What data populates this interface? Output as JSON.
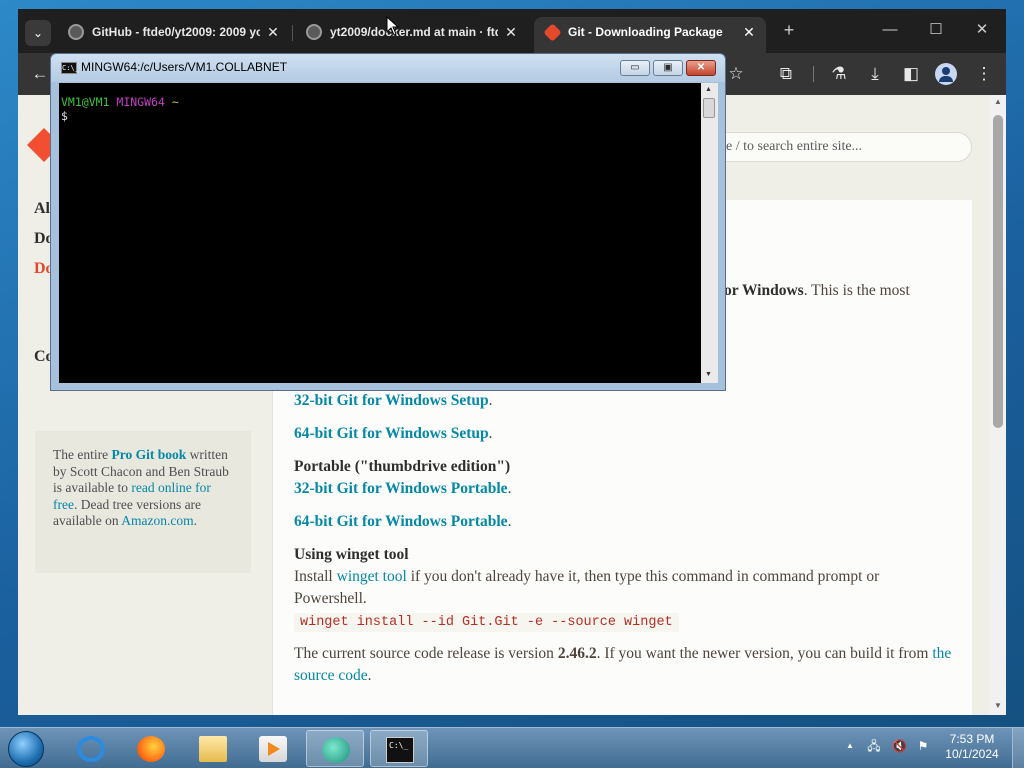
{
  "browser": {
    "tabs": [
      {
        "title": "GitHub - ftde0/yt2009: 2009 yo",
        "close": "✕"
      },
      {
        "title": "yt2009/docker.md at main · ftde",
        "close": "✕"
      },
      {
        "title": "Git - Downloading Package",
        "close": "✕"
      }
    ],
    "tabmenu": "⌄",
    "newtab": "+",
    "window_controls": {
      "minimize": "—",
      "maximize": "☐",
      "close": "✕"
    },
    "toolbar": {
      "back": "←",
      "star": "☆",
      "extensions": "⧉",
      "labs": "⚗",
      "download": "⤓",
      "sidepanel": "◧",
      "menu": "⋮"
    }
  },
  "page": {
    "search_placeholder": "Type / to search entire site...",
    "search_visible": "pe / to search entire site...",
    "sidenav": [
      "Al",
      "Do",
      "Do",
      "Co"
    ],
    "intro_tail_bold": "or Windows",
    "intro_tail": ". This is the most",
    "setup32_partial": "32-bit Git for Windows Setup",
    "setup64": "64-bit Git for Windows Setup",
    "period": ".",
    "portable_heading": "Portable (\"thumbdrive edition\")",
    "portable32": "32-bit Git for Windows Portable",
    "portable64": "64-bit Git for Windows Portable",
    "winget_heading": "Using winget tool",
    "winget_text_1": "Install ",
    "winget_link": "winget tool",
    "winget_text_2": " if you don't already have it, then type this command in command prompt or",
    "winget_text_3": "Powershell.",
    "winget_cmd": "winget install --id Git.Git -e --source winget",
    "release_1": "The current source code release is version ",
    "release_version": "2.46.2",
    "release_2": ". If you want the newer version, you can build it from ",
    "release_link_1": "the",
    "release_link_2": "source code",
    "release_end": ".",
    "probook": {
      "t1": "The entire ",
      "link_book": "Pro Git book",
      "t2": " written by Scott Chacon and Ben Straub is available to ",
      "link_read": "read online for free",
      "t3": ". Dead tree versions are available on ",
      "link_amazon": "Amazon.com",
      "t4": "."
    }
  },
  "terminal": {
    "title": "MINGW64:/c/Users/VM1.COLLABNET",
    "icon_text": "C:\\_",
    "prompt_user": "VM1@VM1",
    "prompt_env": "MINGW64",
    "prompt_dir": "~",
    "prompt_symbol": "$",
    "buttons": {
      "minimize": "▭",
      "maximize": "▣",
      "close": "✕"
    }
  },
  "taskbar": {
    "clock_time": "7:53 PM",
    "clock_date": "10/1/2024",
    "tray": {
      "arrow": "▲",
      "network": "🖧",
      "volume": "🔇",
      "flag": "⚑"
    },
    "cmd_icon_text": "C:\\_"
  },
  "colors": {
    "git_orange": "#f14e32",
    "link_teal": "#0388a6",
    "code_red": "#b52f26",
    "terminal_green": "#3fc43f",
    "terminal_magenta": "#c43fc4"
  }
}
